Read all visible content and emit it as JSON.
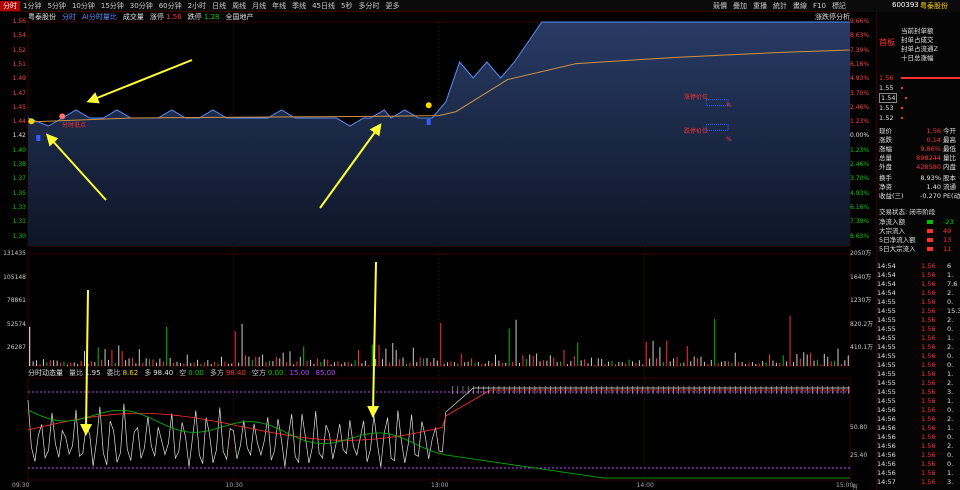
{
  "toolbar": {
    "periods": [
      "分时",
      "1分钟",
      "5分钟",
      "10分钟",
      "15分钟",
      "30分钟",
      "60分钟",
      "2小时",
      "日线",
      "周线",
      "月线",
      "年线",
      "季线",
      "45日线",
      "5秒",
      "多分时",
      "更多"
    ],
    "active_period": 0,
    "right_tools": [
      "競價",
      "疊加",
      "重播",
      "統計",
      "畫線",
      "F10",
      "標記",
      "+自選",
      "返回"
    ]
  },
  "stock": {
    "code": "600393",
    "name": "粤泰股份",
    "panel_title": "首板"
  },
  "chart_header": {
    "name": "粤泰股份",
    "mode": "分时",
    "ai_label": "AI分时量比",
    "volume_label": "成交量",
    "rise_label": "涨停",
    "rise_value": "1.56",
    "fall_label": "跌停",
    "fall_value": "1.28",
    "sector": "全国地产",
    "right_label": "涨跌停分析"
  },
  "sub_header": {
    "title": "分时动态量",
    "items": [
      {
        "label": "量比",
        "value": "1.95",
        "color": "#e0e0e0"
      },
      {
        "label": "委比",
        "value": "8.62",
        "color": "#ffd400"
      },
      {
        "label": "多",
        "value": "98.40",
        "color": "#e0e0e0"
      },
      {
        "label": "空",
        "value": "0.00",
        "color": "#00d000"
      },
      {
        "label": "多方",
        "value": "98.40",
        "color": "#ff3030"
      },
      {
        "label": "空方",
        "value": "0.00",
        "color": "#00d000"
      },
      {
        "label": "",
        "value": "15.00",
        "color": "#c040ff"
      },
      {
        "label": "",
        "value": "85.00",
        "color": "#c040ff"
      }
    ]
  },
  "annotations": {
    "low_price_label": "分时低点",
    "box1_title": "涨停价位",
    "box2_title": "跌停价位",
    "box_value": "%"
  },
  "price_axis_left": [
    "1.56",
    "1.54",
    "1.52",
    "1.51",
    "1.49",
    "1.47",
    "1.45",
    "1.44",
    "1.42",
    "1.40",
    "1.38",
    "1.37",
    "1.35",
    "1.33",
    "1.31",
    "1.30"
  ],
  "price_axis_right": [
    "9.66%",
    "8.63%",
    "7.39%",
    "6.16%",
    "4.93%",
    "3.70%",
    "2.46%",
    "1.23%",
    "0.00%",
    "1.23%",
    "2.46%",
    "3.70%",
    "4.93%",
    "6.16%",
    "7.39%",
    "8.63%"
  ],
  "volume_axis_left": [
    "131435",
    "105148",
    "78861",
    "52574",
    "26287"
  ],
  "volume_axis_right": [
    "2050万",
    "1640万",
    "1230万",
    "820.2万",
    "410.1万"
  ],
  "indicator_axis_right": [
    "50.80",
    "25.40"
  ],
  "time_axis": [
    "09:30",
    "10:30",
    "13:00",
    "14:00",
    "15:00"
  ],
  "time_axis_extra": "有房",
  "chart_data": {
    "type": "line",
    "x_start": "09:30",
    "x_end": "15:00",
    "ylim": [
      1.28,
      1.56
    ],
    "series": [
      {
        "name": "价格",
        "color": "#5b8cff",
        "x": [
          0,
          6,
          10,
          14,
          18,
          22,
          26,
          30,
          34,
          38,
          42,
          46,
          50,
          54,
          58,
          62,
          66,
          70,
          74,
          78,
          82,
          86,
          90,
          94,
          98,
          100,
          104,
          106,
          110,
          114,
          118,
          122,
          126,
          130,
          134,
          138,
          142,
          150,
          160,
          170,
          180,
          200,
          215,
          230,
          240
        ],
        "y": [
          1.44,
          1.43,
          1.44,
          1.45,
          1.44,
          1.44,
          1.45,
          1.44,
          1.44,
          1.44,
          1.45,
          1.44,
          1.44,
          1.45,
          1.44,
          1.44,
          1.44,
          1.44,
          1.45,
          1.44,
          1.44,
          1.44,
          1.44,
          1.43,
          1.44,
          1.44,
          1.45,
          1.44,
          1.45,
          1.44,
          1.44,
          1.46,
          1.51,
          1.49,
          1.51,
          1.49,
          1.51,
          1.56,
          1.56,
          1.56,
          1.56,
          1.56,
          1.56,
          1.56,
          1.56
        ]
      },
      {
        "name": "均价",
        "color": "#d09040",
        "x": [
          0,
          30,
          60,
          100,
          120,
          125,
          140,
          160,
          190,
          220,
          240
        ],
        "y": [
          1.435,
          1.44,
          1.441,
          1.442,
          1.443,
          1.448,
          1.488,
          1.508,
          1.516,
          1.522,
          1.525
        ]
      }
    ],
    "volume_bars": [
      2050,
      300,
      250,
      200,
      400,
      150,
      500,
      300,
      200,
      250,
      200,
      180,
      220,
      150,
      200,
      300,
      600,
      200,
      250,
      150,
      1400,
      300,
      2200,
      400,
      700,
      300,
      1200,
      600,
      500,
      400,
      300,
      200,
      800,
      400,
      500,
      300,
      700,
      200,
      300,
      400
    ]
  },
  "info": {
    "labels_right_top": [
      "当前封单额",
      "封单占成交",
      "封单占流通Z",
      "十日总涨幅"
    ],
    "order_book": [
      {
        "price": "1.56",
        "color": "#ff3030"
      },
      {
        "price": "1.55",
        "color": "#e0e0e0"
      },
      {
        "price": "1.54",
        "color": "#e0e0e0"
      },
      {
        "price": "1.53",
        "color": "#e0e0e0"
      },
      {
        "price": "1.52",
        "color": "#e0e0e0"
      }
    ],
    "quote": [
      {
        "k": "现价",
        "v": "1.56",
        "k2": "今开"
      },
      {
        "k": "涨跌",
        "v": "0.14",
        "k2": "最高"
      },
      {
        "k": "涨幅",
        "v": "9.86%",
        "k2": "最低"
      },
      {
        "k": "总量",
        "v": "898244",
        "k2": "量比"
      },
      {
        "k": "外盘",
        "v": "428580",
        "k2": "内盘"
      }
    ],
    "quote2": [
      {
        "k": "换手",
        "v": "8.93%",
        "k2": "股本"
      },
      {
        "k": "净资",
        "v": "1.40",
        "k2": "流通"
      },
      {
        "k": "收益(三)",
        "v": "-0.270",
        "k2": "PE(动)"
      }
    ],
    "trade_status": "交易状态: 闭市阶段",
    "flows": [
      {
        "k": "净流入额",
        "v": "-23"
      },
      {
        "k": "大宗流入",
        "v": "49"
      },
      {
        "k": "5日净流入额",
        "v": "13"
      },
      {
        "k": "5日大宗流入",
        "v": "11"
      }
    ],
    "trades": [
      {
        "t": "14:54",
        "p": "1.56",
        "v": "6"
      },
      {
        "t": "14:54",
        "p": "1.56",
        "v": "1."
      },
      {
        "t": "14:54",
        "p": "1.56",
        "v": "7.6"
      },
      {
        "t": "14:54",
        "p": "1.56",
        "v": "2."
      },
      {
        "t": "14:55",
        "p": "1.56",
        "v": "0."
      },
      {
        "t": "14:55",
        "p": "1.56",
        "v": "15.3"
      },
      {
        "t": "14:55",
        "p": "1.56",
        "v": "2."
      },
      {
        "t": "14:55",
        "p": "1.56",
        "v": "0."
      },
      {
        "t": "14:55",
        "p": "1.56",
        "v": "1."
      },
      {
        "t": "14:55",
        "p": "1.56",
        "v": "2."
      },
      {
        "t": "14:55",
        "p": "1.56",
        "v": "0."
      },
      {
        "t": "14:55",
        "p": "1.56",
        "v": "0."
      },
      {
        "t": "14:55",
        "p": "1.56",
        "v": "1."
      },
      {
        "t": "14:55",
        "p": "1.56",
        "v": "2."
      },
      {
        "t": "14:55",
        "p": "1.56",
        "v": "3."
      },
      {
        "t": "14:55",
        "p": "1.56",
        "v": "1."
      },
      {
        "t": "14:56",
        "p": "1.56",
        "v": "0."
      },
      {
        "t": "14:56",
        "p": "1.56",
        "v": "2."
      },
      {
        "t": "14:56",
        "p": "1.56",
        "v": "1."
      },
      {
        "t": "14:56",
        "p": "1.56",
        "v": "0."
      },
      {
        "t": "14:56",
        "p": "1.56",
        "v": "2."
      },
      {
        "t": "14:56",
        "p": "1.56",
        "v": "0."
      },
      {
        "t": "14:56",
        "p": "1.56",
        "v": "0."
      },
      {
        "t": "14:56",
        "p": "1.56",
        "v": "1."
      },
      {
        "t": "14:57",
        "p": "1.56",
        "v": "3."
      }
    ]
  }
}
